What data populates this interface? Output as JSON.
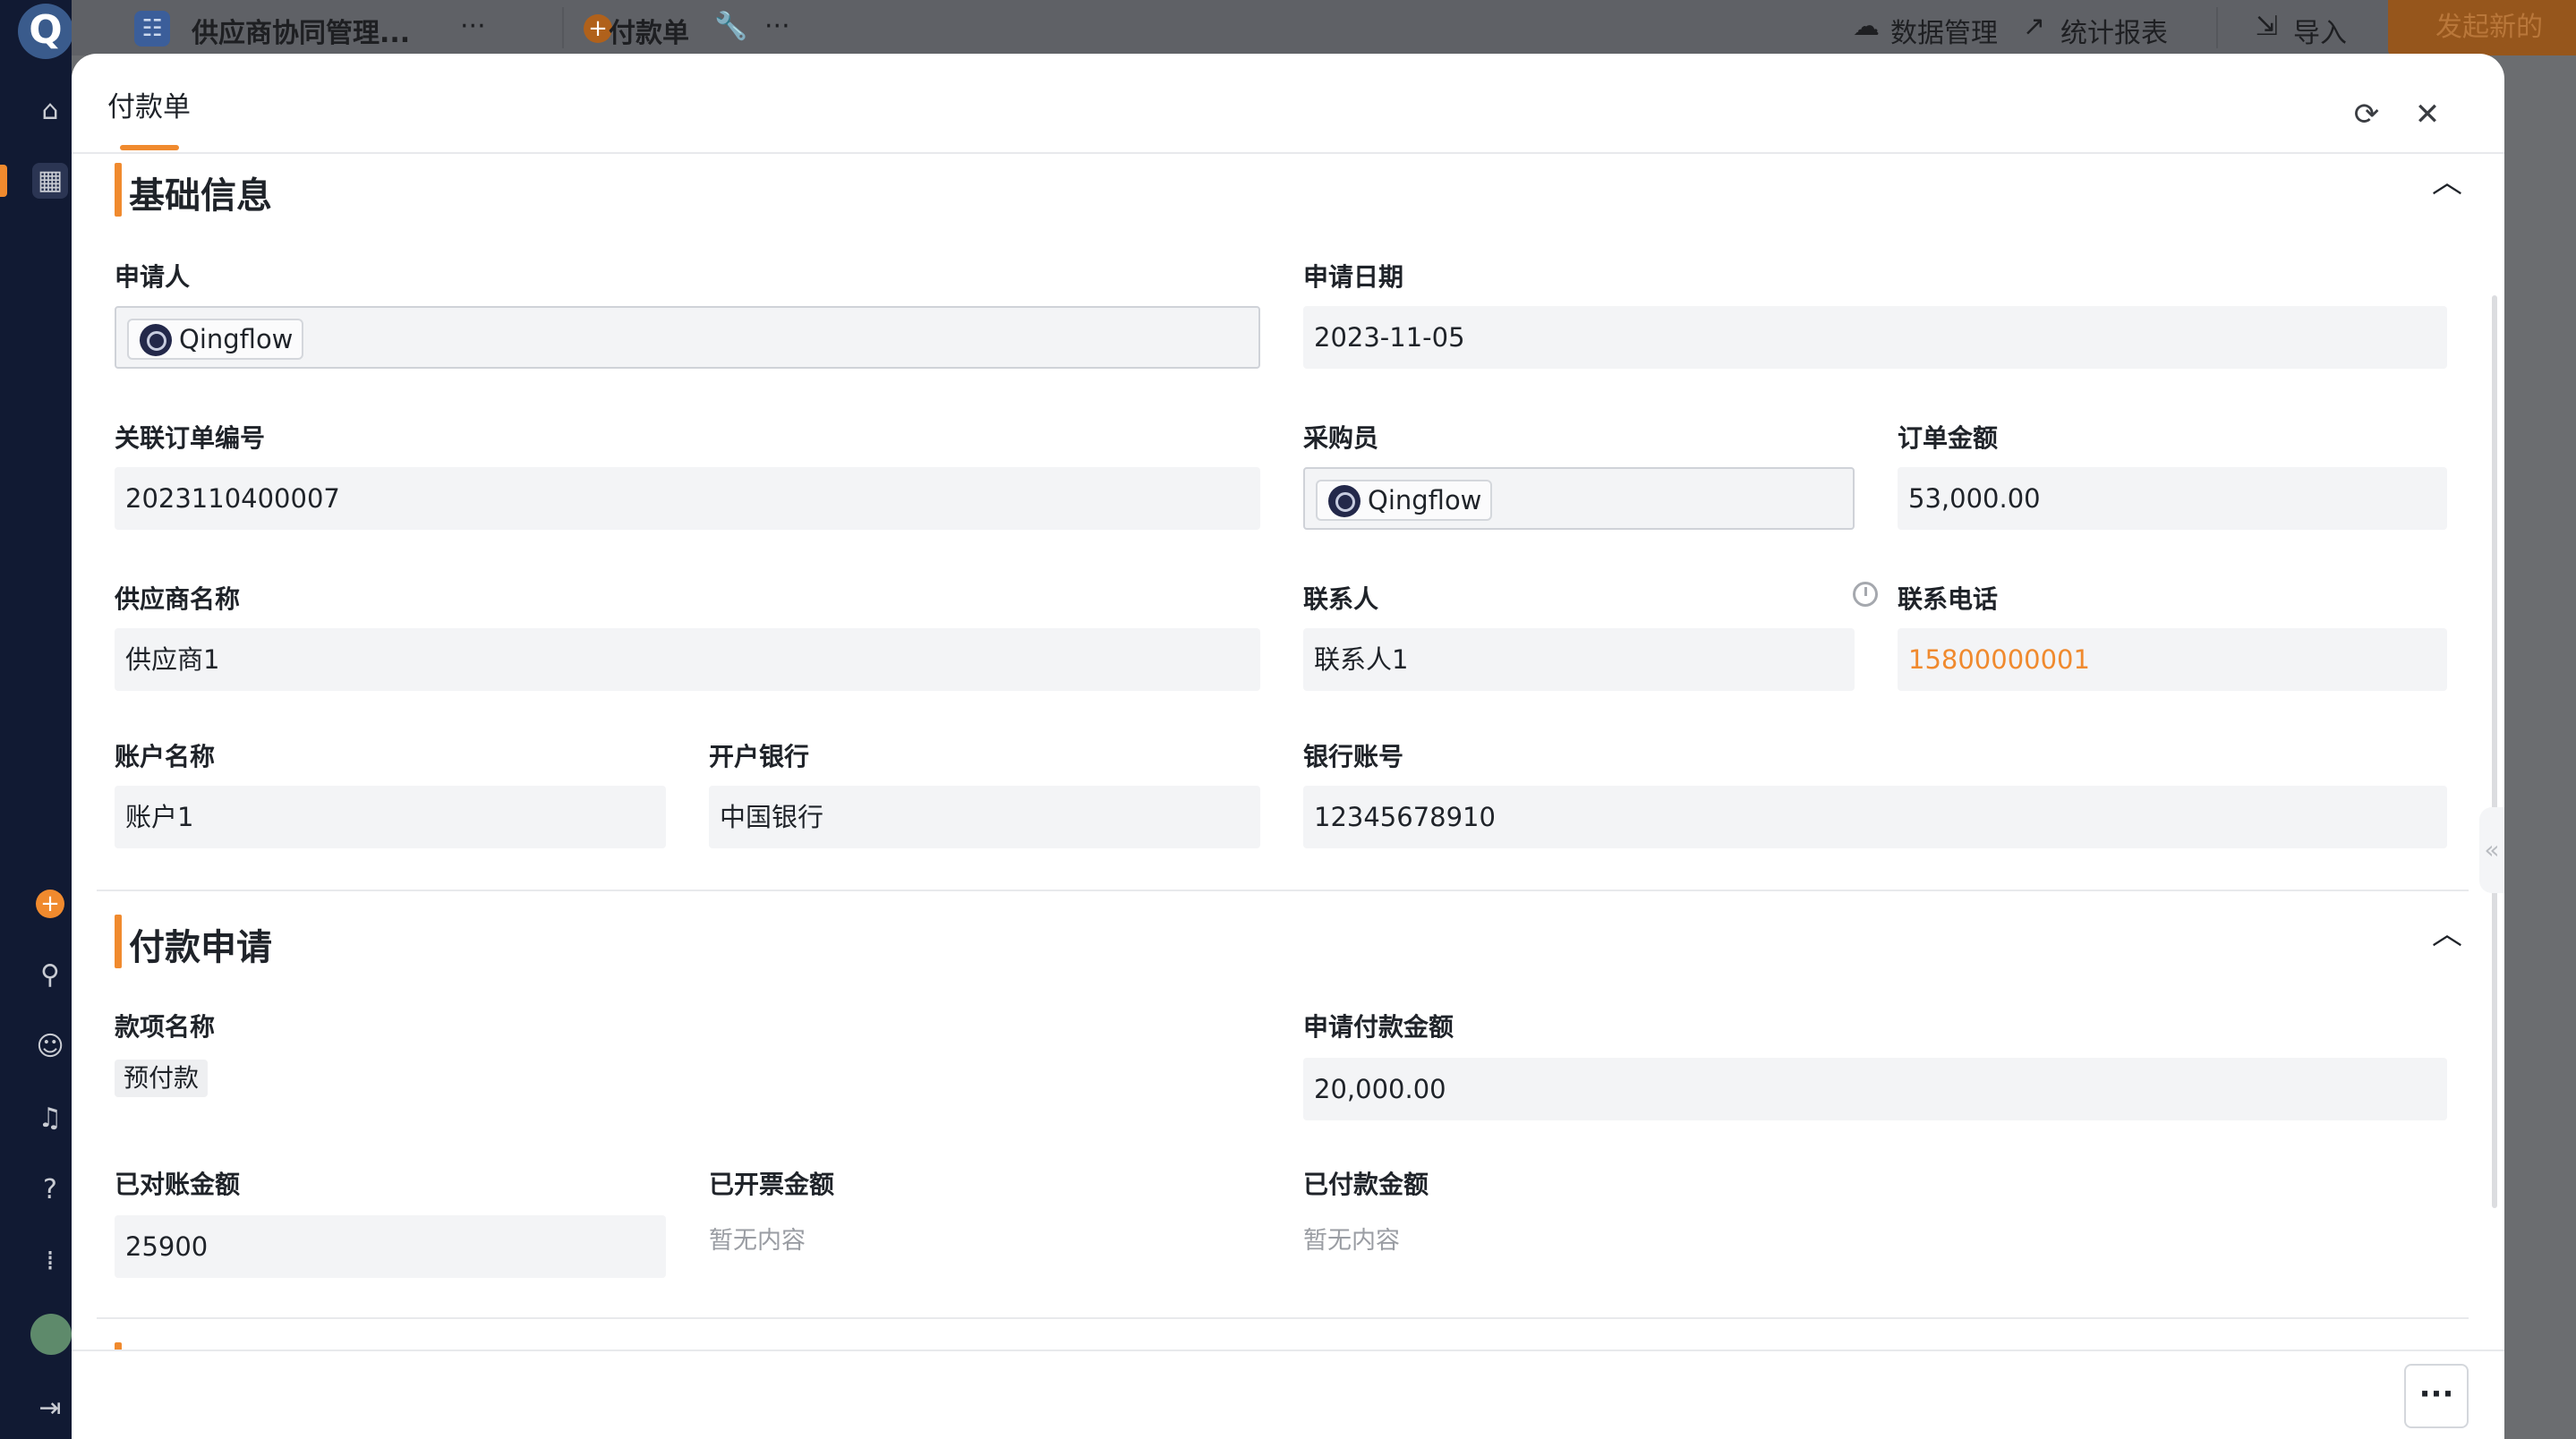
{
  "topbar": {
    "app_name": "供应商协同管理...",
    "app_more": "···",
    "add": "+",
    "form_name": "付款单",
    "form_more": "···",
    "data_manage": "数据管理",
    "stats_report": "统计报表",
    "import": "导入",
    "start_new": "发起新的"
  },
  "modal": {
    "title": "付款单"
  },
  "section_basic": {
    "title": "基础信息",
    "applicant_label": "申请人",
    "applicant_value": "Qingflow",
    "apply_date_label": "申请日期",
    "apply_date_value": "2023-11-05",
    "order_no_label": "关联订单编号",
    "order_no_value": "2023110400007",
    "buyer_label": "采购员",
    "buyer_value": "Qingflow",
    "order_amount_label": "订单金额",
    "order_amount_value": "53,000.00",
    "supplier_label": "供应商名称",
    "supplier_value": "供应商1",
    "contact_label": "联系人",
    "contact_value": "联系人1",
    "phone_label": "联系电话",
    "phone_value": "15800000001",
    "account_name_label": "账户名称",
    "account_name_value": "账户1",
    "bank_label": "开户银行",
    "bank_value": "中国银行",
    "bank_account_label": "银行账号",
    "bank_account_value": "12345678910"
  },
  "section_payment": {
    "title": "付款申请",
    "item_name_label": "款项名称",
    "item_name_value": "预付款",
    "request_amount_label": "申请付款金额",
    "request_amount_value": "20,000.00",
    "reconciled_label": "已对账金额",
    "reconciled_value": "25900",
    "invoiced_label": "已开票金额",
    "invoiced_value": "暂无内容",
    "paid_label": "已付款金额",
    "paid_value": "暂无内容"
  },
  "footer": {
    "more": "···"
  },
  "colors": {
    "accent": "#f08a2e",
    "rail": "#111a33"
  },
  "icons": [
    "home-icon",
    "grid-icon",
    "search-icon",
    "users-icon",
    "bell-icon",
    "help-icon",
    "apps-icon",
    "refresh-icon",
    "close-icon",
    "chevron-up-icon",
    "clock-icon"
  ]
}
